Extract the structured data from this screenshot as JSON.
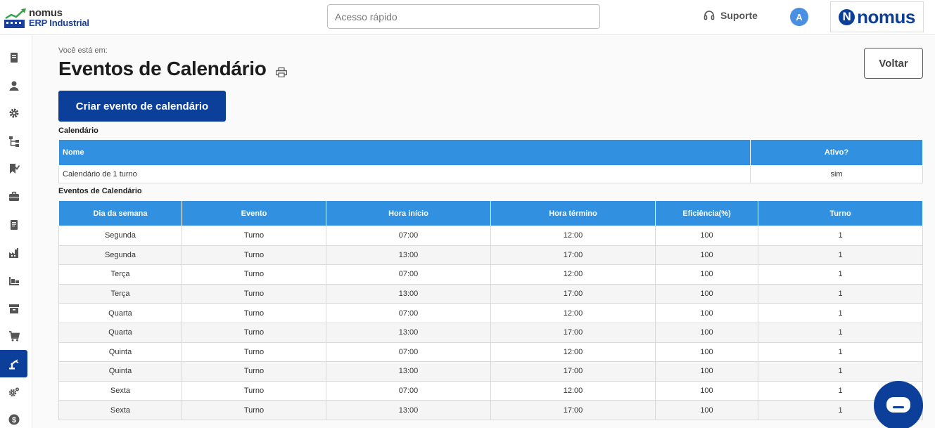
{
  "header": {
    "logo_line1": "nomus",
    "logo_line2": "ERP Industrial",
    "search_placeholder": "Acesso rápido",
    "support_label": "Suporte",
    "avatar_initial": "A",
    "brand_text": "nomus",
    "brand_letter": "N"
  },
  "sidebar": {
    "items": [
      {
        "icon": "book-icon"
      },
      {
        "icon": "user-icon"
      },
      {
        "icon": "gear-icon"
      },
      {
        "icon": "hierarchy-icon"
      },
      {
        "icon": "bookmark-check-icon"
      },
      {
        "icon": "briefcase-icon"
      },
      {
        "icon": "ledger-icon"
      },
      {
        "icon": "factory-icon"
      },
      {
        "icon": "pallet-icon"
      },
      {
        "icon": "archive-icon"
      },
      {
        "icon": "cart-icon"
      },
      {
        "icon": "robot-arm-icon",
        "active": true
      },
      {
        "icon": "gears-icon"
      },
      {
        "icon": "dollar-icon"
      }
    ]
  },
  "page": {
    "breadcrumb": "Você está em:",
    "title": "Eventos de Calendário",
    "back_button": "Voltar",
    "create_button": "Criar evento de calendário"
  },
  "calendar_section": {
    "label": "Calendário",
    "columns": [
      "Nome",
      "Ativo?"
    ],
    "rows": [
      [
        "Calendário de 1 turno",
        "sim"
      ]
    ]
  },
  "events_section": {
    "label": "Eventos de Calendário",
    "columns": [
      "Dia da semana",
      "Evento",
      "Hora início",
      "Hora término",
      "Eficiência(%)",
      "Turno"
    ],
    "rows": [
      [
        "Segunda",
        "Turno",
        "07:00",
        "12:00",
        "100",
        "1"
      ],
      [
        "Segunda",
        "Turno",
        "13:00",
        "17:00",
        "100",
        "1"
      ],
      [
        "Terça",
        "Turno",
        "07:00",
        "12:00",
        "100",
        "1"
      ],
      [
        "Terça",
        "Turno",
        "13:00",
        "17:00",
        "100",
        "1"
      ],
      [
        "Quarta",
        "Turno",
        "07:00",
        "12:00",
        "100",
        "1"
      ],
      [
        "Quarta",
        "Turno",
        "13:00",
        "17:00",
        "100",
        "1"
      ],
      [
        "Quinta",
        "Turno",
        "07:00",
        "12:00",
        "100",
        "1"
      ],
      [
        "Quinta",
        "Turno",
        "13:00",
        "17:00",
        "100",
        "1"
      ],
      [
        "Sexta",
        "Turno",
        "07:00",
        "12:00",
        "100",
        "1"
      ],
      [
        "Sexta",
        "Turno",
        "13:00",
        "17:00",
        "100",
        "1"
      ]
    ]
  },
  "colors": {
    "primary": "#0b3f9a",
    "table_header": "#3191e0",
    "avatar": "#4a90e2"
  }
}
